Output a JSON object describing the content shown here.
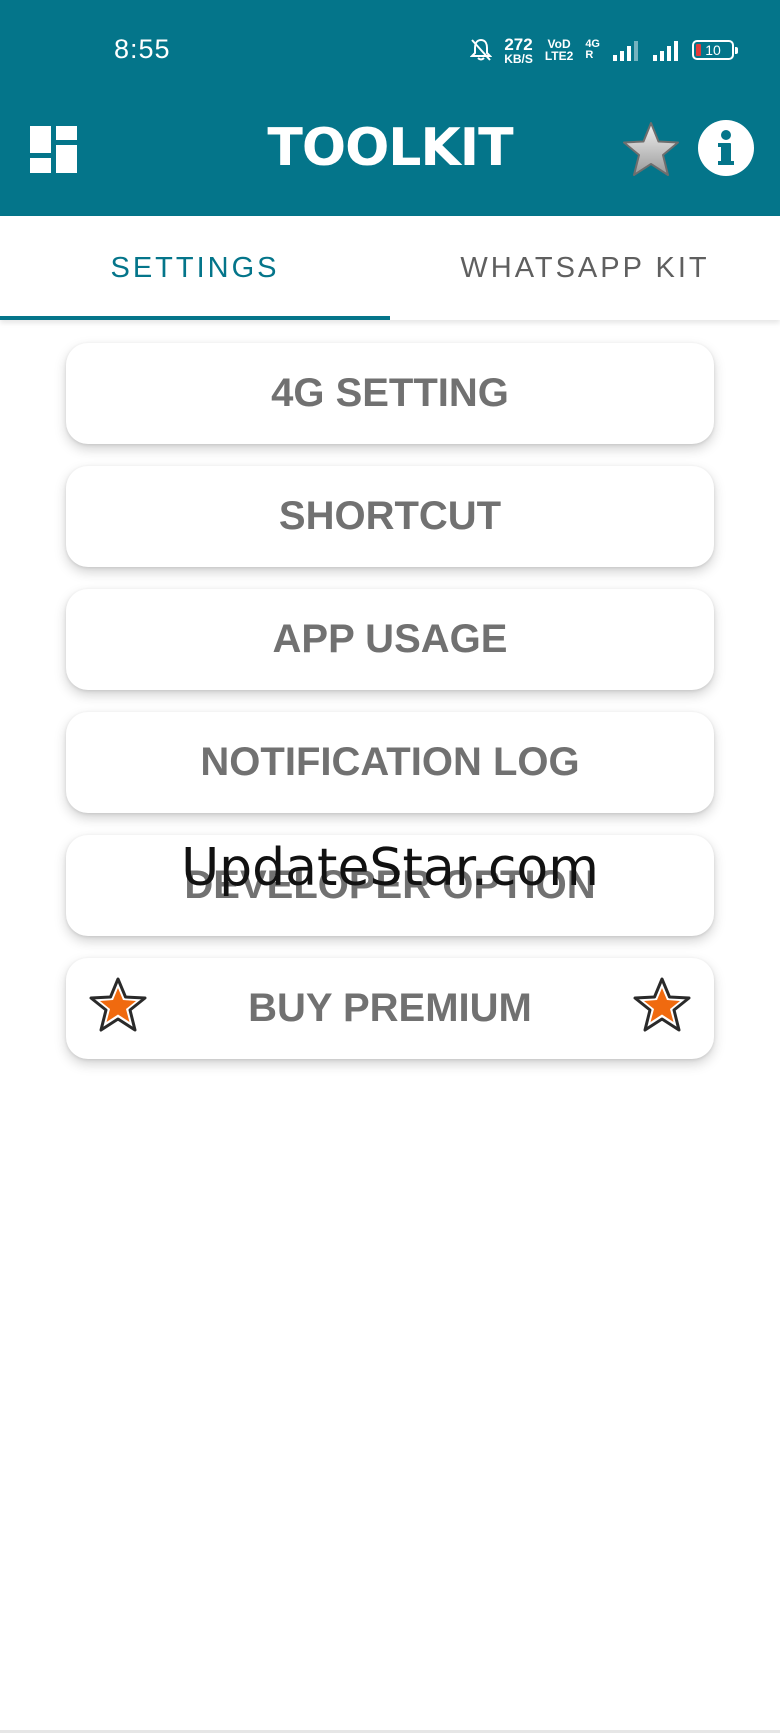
{
  "status_bar": {
    "time": "8:55",
    "speed_value": "272",
    "speed_unit": "KB/S",
    "volte_top": "VoD",
    "volte_bottom": "LTE2",
    "network_top": "4G",
    "network_bottom": "R",
    "battery": "10"
  },
  "app_bar": {
    "title": "TOOLKIT",
    "menu_icon": "dashboard-icon",
    "rate_icon": "star-icon",
    "info_icon": "info-icon"
  },
  "tabs": [
    {
      "label": "SETTINGS",
      "selected": true
    },
    {
      "label": "WHATSAPP KIT",
      "selected": false
    }
  ],
  "menu_items": [
    {
      "label": "4G SETTING"
    },
    {
      "label": "SHORTCUT"
    },
    {
      "label": "APP USAGE"
    },
    {
      "label": "NOTIFICATION LOG"
    },
    {
      "label": "DEVELOPER OPTION"
    },
    {
      "label": "BUY PREMIUM"
    }
  ],
  "watermark": "UpdateStar.com",
  "colors": {
    "primary": "#04758a",
    "card_text": "#717171",
    "inactive_tab": "#5f5f5f",
    "premium_star": "#f06a0f"
  }
}
